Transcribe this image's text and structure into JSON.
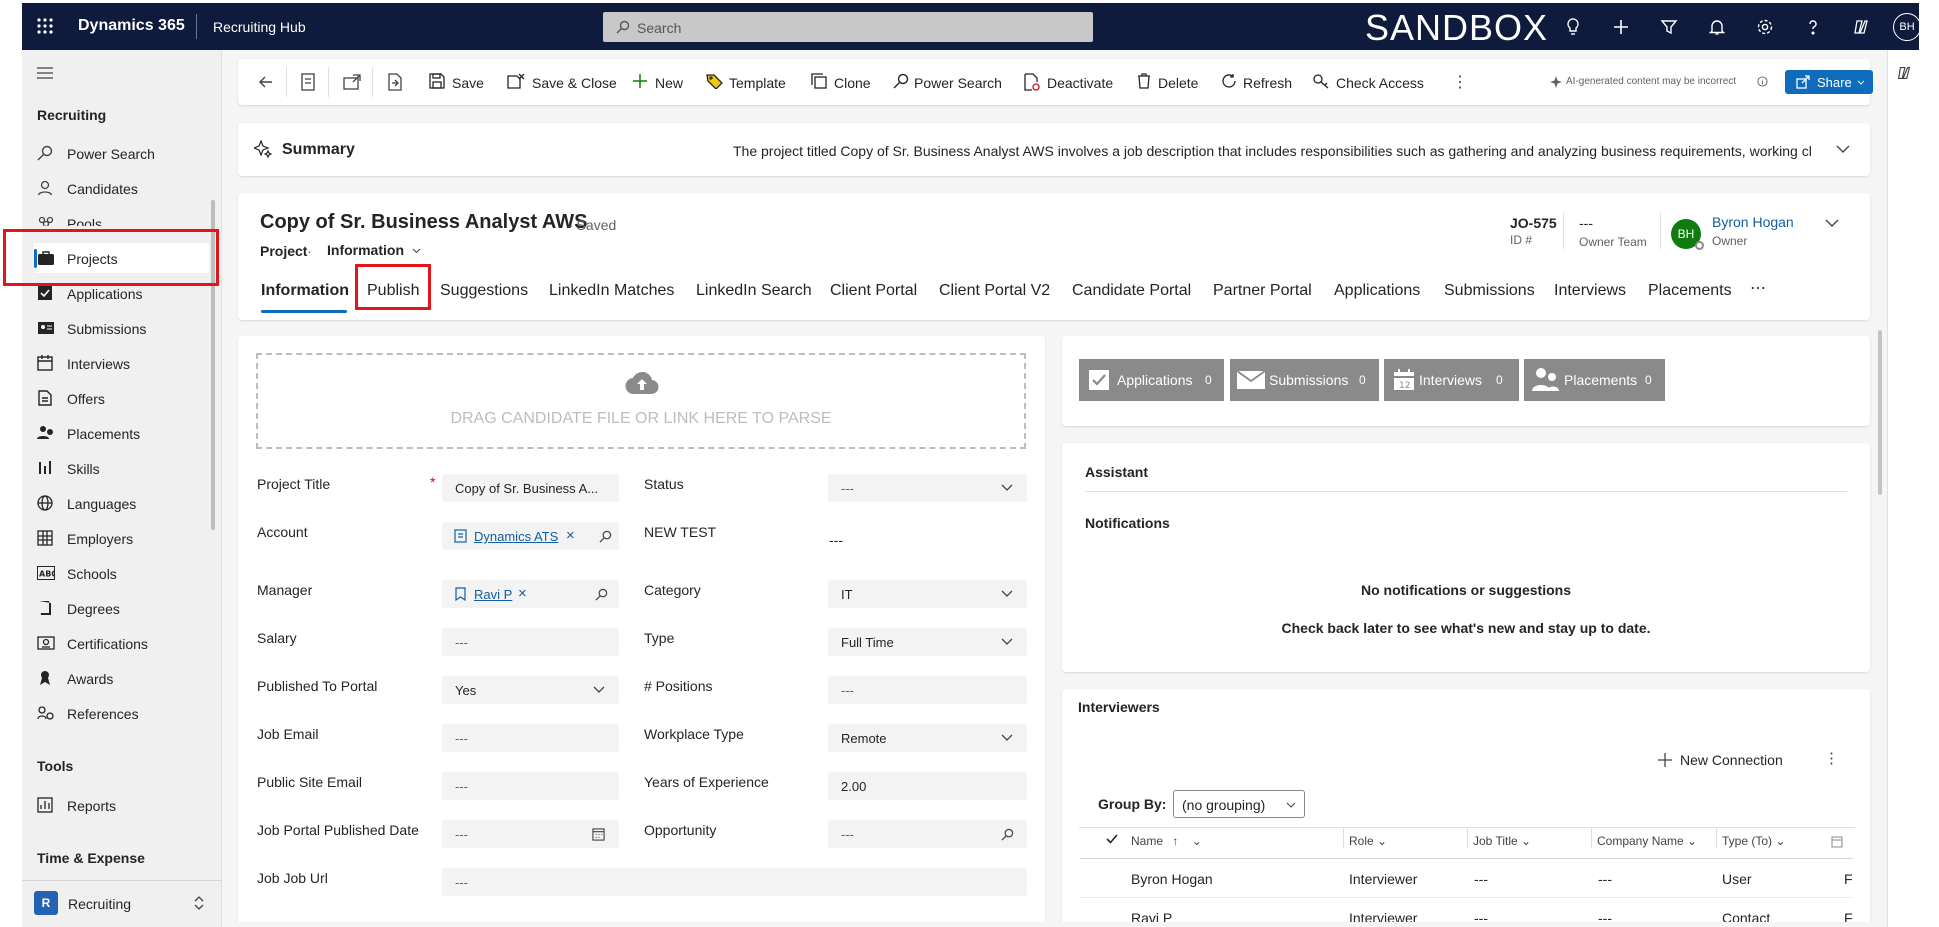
{
  "topbar": {
    "app_name": "Dynamics 365",
    "hub_name": "Recruiting Hub",
    "search_placeholder": "Search",
    "environment": "SANDBOX",
    "user_initials": "BH"
  },
  "nav": {
    "section_recruiting": "Recruiting",
    "items": [
      {
        "label": "Power Search",
        "icon": "search-icon"
      },
      {
        "label": "Candidates",
        "icon": "person-icon"
      },
      {
        "label": "Pools",
        "icon": "people-icon"
      },
      {
        "label": "Projects",
        "icon": "briefcase-icon",
        "active": true
      },
      {
        "label": "Applications",
        "icon": "checkbox-icon"
      },
      {
        "label": "Submissions",
        "icon": "id-card-icon"
      },
      {
        "label": "Interviews",
        "icon": "calendar-icon"
      },
      {
        "label": "Offers",
        "icon": "document-icon"
      },
      {
        "label": "Placements",
        "icon": "group-icon"
      },
      {
        "label": "Skills",
        "icon": "skills-icon"
      },
      {
        "label": "Languages",
        "icon": "globe-icon"
      },
      {
        "label": "Employers",
        "icon": "building-icon"
      },
      {
        "label": "Schools",
        "icon": "abc-icon"
      },
      {
        "label": "Degrees",
        "icon": "book-icon"
      },
      {
        "label": "Certifications",
        "icon": "certificate-icon"
      },
      {
        "label": "Awards",
        "icon": "award-icon"
      },
      {
        "label": "References",
        "icon": "reference-icon"
      }
    ],
    "section_tools": "Tools",
    "tools_items": [
      {
        "label": "Reports",
        "icon": "report-icon"
      }
    ],
    "section_time": "Time & Expense",
    "area_initial": "R",
    "area_label": "Recruiting"
  },
  "commands": {
    "save": "Save",
    "save_close": "Save & Close",
    "new": "New",
    "template": "Template",
    "clone": "Clone",
    "power_search": "Power Search",
    "deactivate": "Deactivate",
    "delete": "Delete",
    "refresh": "Refresh",
    "check_access": "Check Access",
    "ai_notice": "AI-generated content may be incorrect",
    "share": "Share"
  },
  "summary": {
    "title": "Summary",
    "text": "The project titled Copy of Sr. Business Analyst AWS involves a job description that includes responsibilities such as gathering and analyzing business requirements, working cl..."
  },
  "record": {
    "title": "Copy of Sr. Business Analyst AWS",
    "saved": "- Saved",
    "entity": "Project",
    "form": "Information",
    "id_value": "JO-575",
    "id_label": "ID #",
    "owner_team_value": "---",
    "owner_team_label": "Owner Team",
    "owner_initials": "BH",
    "owner_name": "Byron Hogan",
    "owner_label": "Owner"
  },
  "tabs": [
    "Information",
    "Publish",
    "Suggestions",
    "LinkedIn Matches",
    "LinkedIn Search",
    "Client Portal",
    "Client Portal V2",
    "Candidate Portal",
    "Partner Portal",
    "Applications",
    "Submissions",
    "Interviews",
    "Placements",
    "⋯"
  ],
  "dropzone": "DRAG CANDIDATE FILE OR LINK HERE TO PARSE",
  "form_left": {
    "project_title_label": "Project Title",
    "project_title_value": "Copy of Sr. Business A...",
    "account_label": "Account",
    "account_value": "Dynamics ATS",
    "manager_label": "Manager",
    "manager_value": "Ravi P",
    "salary_label": "Salary",
    "salary_value": "---",
    "published_label": "Published To Portal",
    "published_value": "Yes",
    "job_email_label": "Job Email",
    "job_email_value": "---",
    "public_email_label": "Public Site Email",
    "public_email_value": "---",
    "portal_date_label": "Job Portal Published Date",
    "portal_date_value": "---",
    "job_url_label": "Job Job Url",
    "job_url_value": "---"
  },
  "form_right": {
    "status_label": "Status",
    "status_value": "---",
    "new_test_label": "NEW TEST",
    "new_test_value": "---",
    "category_label": "Category",
    "category_value": "IT",
    "type_label": "Type",
    "type_value": "Full Time",
    "positions_label": "# Positions",
    "positions_value": "---",
    "workplace_label": "Workplace Type",
    "workplace_value": "Remote",
    "experience_label": "Years of Experience",
    "experience_value": "2.00",
    "opportunity_label": "Opportunity",
    "opportunity_value": "---"
  },
  "stats": [
    {
      "label": "Applications",
      "count": "0"
    },
    {
      "label": "Submissions",
      "count": "0"
    },
    {
      "label": "Interviews",
      "count": "0"
    },
    {
      "label": "Placements",
      "count": "0"
    }
  ],
  "assistant": {
    "title": "Assistant",
    "notifications": "Notifications",
    "empty_title": "No notifications or suggestions",
    "empty_sub": "Check back later to see what's new and stay up to date."
  },
  "interviewers": {
    "title": "Interviewers",
    "new_connection": "New Connection",
    "group_by_label": "Group By:",
    "group_by_value": "(no grouping)",
    "columns": [
      "Name",
      "Role",
      "Job Title",
      "Company Name",
      "Type (To)"
    ],
    "rows": [
      {
        "name": "Byron Hogan",
        "role": "Interviewer",
        "job_title": "---",
        "company": "---",
        "type": "User",
        "extra": "F"
      },
      {
        "name": "Ravi P",
        "role": "Interviewer",
        "job_title": "---",
        "company": "---",
        "type": "Contact",
        "extra": "F"
      }
    ]
  },
  "colors": {
    "topbar": "#0f1b3c",
    "accent": "#0f6cbd",
    "highlight": "#e0161b",
    "owner_avatar": "#107c10"
  }
}
